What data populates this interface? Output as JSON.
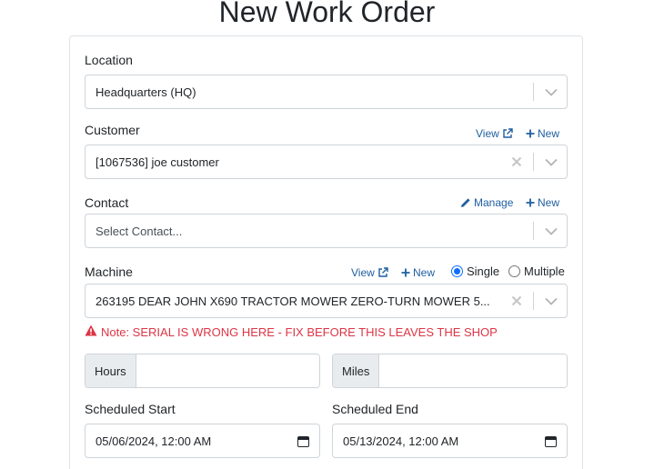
{
  "page": {
    "title": "New Work Order"
  },
  "location": {
    "label": "Location",
    "value": "Headquarters (HQ)"
  },
  "customer": {
    "label": "Customer",
    "view_label": "View",
    "new_label": "New",
    "value": "[1067536] joe customer"
  },
  "contact": {
    "label": "Contact",
    "manage_label": "Manage",
    "new_label": "New",
    "placeholder": "Select Contact..."
  },
  "machine": {
    "label": "Machine",
    "view_label": "View",
    "new_label": "New",
    "mode_options": [
      "Single",
      "Multiple"
    ],
    "mode_selected": "Single",
    "value": "263195 DEAR JOHN X690 TRACTOR MOWER ZERO-TURN MOWER 5...",
    "note": "Note: SERIAL IS WRONG HERE - FIX BEFORE THIS LEAVES THE SHOP"
  },
  "hours": {
    "label": "Hours",
    "value": ""
  },
  "miles": {
    "label": "Miles",
    "value": ""
  },
  "scheduled_start": {
    "label": "Scheduled Start",
    "value": "05/06/2024, 12:00  AM"
  },
  "scheduled_end": {
    "label": "Scheduled End",
    "value": "05/13/2024, 12:00  AM"
  },
  "colors": {
    "link": "#1f5fa0",
    "danger": "#dc3545",
    "primary": "#0d6efd",
    "border": "#ced4da",
    "addon_bg": "#e9ecef"
  }
}
